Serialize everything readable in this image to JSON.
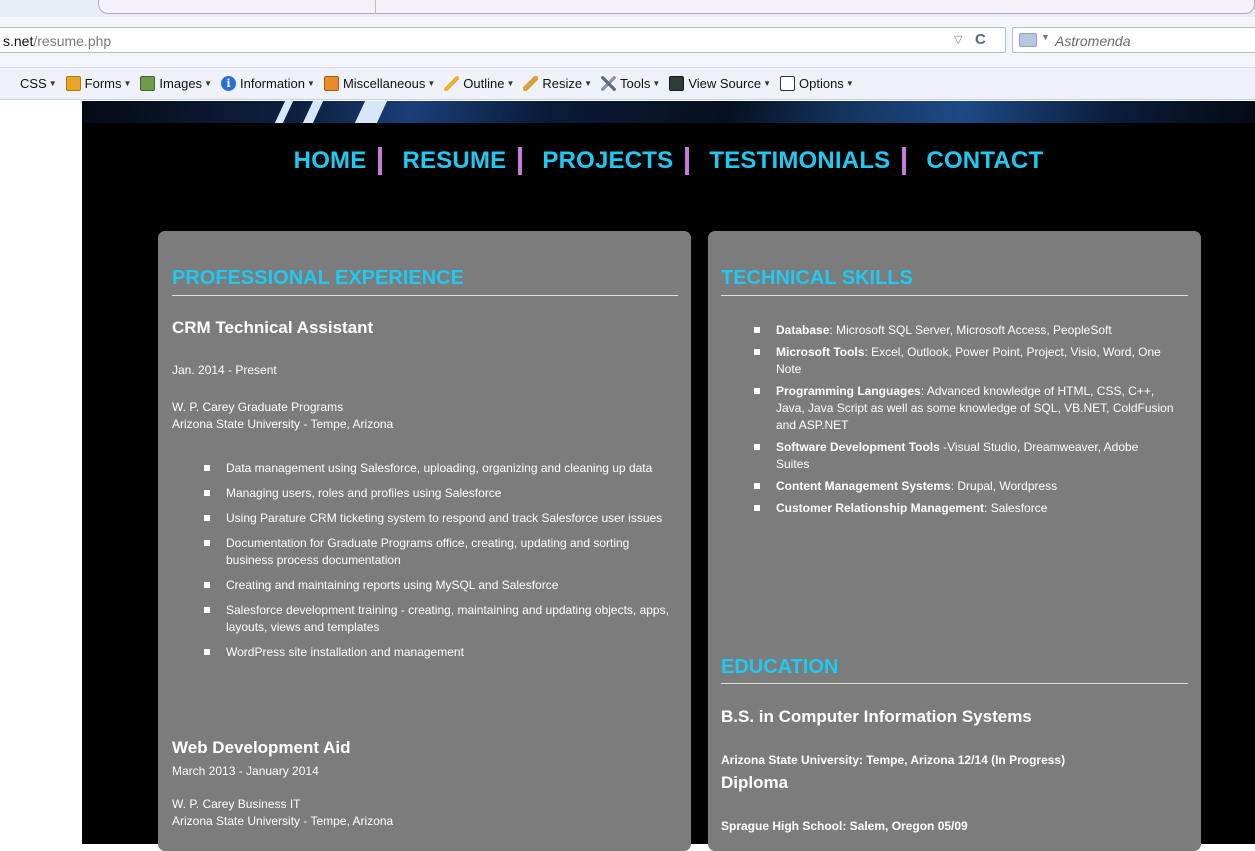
{
  "browser": {
    "url_host": "s.net",
    "url_path": "/resume.php",
    "search_placeholder": "Astromenda",
    "toolbar": [
      {
        "label": "CSS",
        "icon": "css-icon"
      },
      {
        "label": "Forms",
        "icon": "forms-icon"
      },
      {
        "label": "Images",
        "icon": "images-icon"
      },
      {
        "label": "Information",
        "icon": "information-icon"
      },
      {
        "label": "Miscellaneous",
        "icon": "miscellaneous-icon"
      },
      {
        "label": "Outline",
        "icon": "outline-icon"
      },
      {
        "label": "Resize",
        "icon": "resize-icon"
      },
      {
        "label": "Tools",
        "icon": "tools-icon"
      },
      {
        "label": "View Source",
        "icon": "view-source-icon"
      },
      {
        "label": "Options",
        "icon": "options-icon"
      }
    ]
  },
  "nav": [
    "HOME",
    "RESUME",
    "PROJECTS",
    "TESTIMONIALS",
    "CONTACT"
  ],
  "experience": {
    "title": "PROFESSIONAL EXPERIENCE",
    "jobs": [
      {
        "role": "CRM Technical Assistant",
        "dates": "Jan. 2014 - Present",
        "org": "W. P. Carey Graduate Programs",
        "location": "Arizona State University - Tempe, Arizona",
        "duties": [
          "Data management using Salesforce, uploading, organizing and cleaning up data",
          "Managing users, roles and profiles using Salesforce",
          "Using Parature CRM ticketing system to respond and track Salesforce user issues",
          "Documentation for Graduate Programs office, creating, updating and sorting business process documentation",
          "Creating and maintaining reports using MySQL and Salesforce",
          "Salesforce development training - creating, maintaining and updating objects, apps, layouts, views and templates",
          "WordPress site installation and management"
        ]
      },
      {
        "role": "Web Development Aid",
        "dates": "March 2013 - January 2014",
        "org": "W. P. Carey Business IT",
        "location": "Arizona State University - Tempe, Arizona"
      }
    ]
  },
  "skills": {
    "title": "TECHNICAL SKILLS",
    "items": [
      {
        "name": "Database",
        "detail": ": Microsoft SQL Server, Microsoft Access, PeopleSoft"
      },
      {
        "name": "Microsoft Tools",
        "detail": ": Excel, Outlook, Power Point, Project, Visio, Word, One Note"
      },
      {
        "name": "Programming Languages",
        "detail": ": Advanced knowledge of HTML, CSS, C++, Java, Java Script as well as some knowledge of SQL, VB.NET, ColdFusion and ASP.NET"
      },
      {
        "name": "Software Development Tools",
        "detail": " -Visual Studio, Dreamweaver, Adobe Suites"
      },
      {
        "name": "Content Management Systems",
        "detail": ": Drupal, Wordpress"
      },
      {
        "name": "Customer Relationship Management",
        "detail": ": Salesforce"
      }
    ]
  },
  "education": {
    "title": "EDUCATION",
    "degree": "B.S. in Computer Information Systems",
    "school": "Arizona State University: Tempe, Arizona 12/14 (In Progress)",
    "diploma": "Diploma",
    "high_school": "Sprague High School: Salem, Oregon 05/09"
  },
  "colors": {
    "accent": "#1ec9f2",
    "nav_separator": "#c67bd8",
    "panel": "#7c7c7c",
    "page_bg": "#000000"
  }
}
